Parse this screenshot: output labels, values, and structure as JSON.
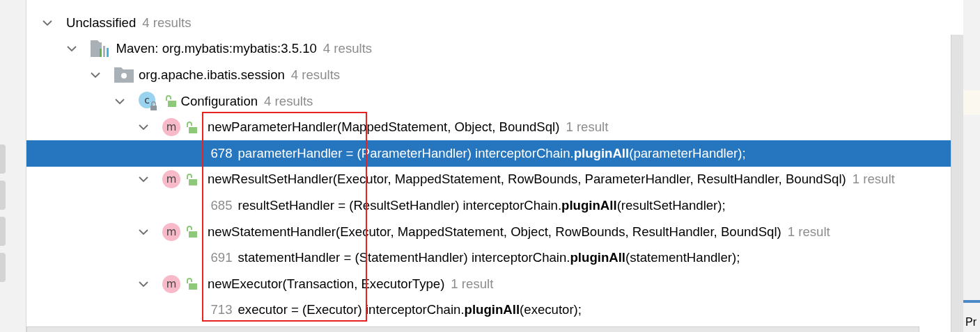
{
  "tree": [
    {
      "kind": "group",
      "label": "Unclassified",
      "count": "4 results",
      "expanded": true,
      "children": [
        {
          "kind": "library",
          "label": "Maven: org.mybatis:mybatis:3.5.10",
          "count": "4 results",
          "expanded": true,
          "children": [
            {
              "kind": "package",
              "label": "org.apache.ibatis.session",
              "count": "4 results",
              "expanded": true,
              "children": [
                {
                  "kind": "class",
                  "badge": "c",
                  "label": "Configuration",
                  "count": "4 results",
                  "expanded": true,
                  "children": [
                    {
                      "kind": "method",
                      "badge": "m",
                      "label": "newParameterHandler(MappedStatement, Object, BoundSql)",
                      "count": "1 result",
                      "expanded": true,
                      "children": [
                        {
                          "kind": "usage",
                          "line": "678",
                          "code": "parameterHandler = (ParameterHandler) interceptorChain.**pluginAll**(parameterHandler);",
                          "selected": true
                        }
                      ]
                    },
                    {
                      "kind": "method",
                      "badge": "m",
                      "label": "newResultSetHandler(Executor, MappedStatement, RowBounds, ParameterHandler, ResultHandler, BoundSql)",
                      "count": "1 result",
                      "expanded": true,
                      "children": [
                        {
                          "kind": "usage",
                          "line": "685",
                          "code": "resultSetHandler = (ResultSetHandler) interceptorChain.**pluginAll**(resultSetHandler);",
                          "selected": false
                        }
                      ]
                    },
                    {
                      "kind": "method",
                      "badge": "m",
                      "label": "newStatementHandler(Executor, MappedStatement, Object, RowBounds, ResultHandler, BoundSql)",
                      "count": "1 result",
                      "expanded": true,
                      "children": [
                        {
                          "kind": "usage",
                          "line": "691",
                          "code": "statementHandler = (StatementHandler) interceptorChain.**pluginAll**(statementHandler);",
                          "selected": false
                        }
                      ]
                    },
                    {
                      "kind": "method",
                      "badge": "m",
                      "label": "newExecutor(Transaction, ExecutorType)",
                      "count": "1 result",
                      "expanded": true,
                      "children": [
                        {
                          "kind": "usage",
                          "line": "713",
                          "code": "executor = (Executor) interceptorChain.**pluginAll**(executor);",
                          "selected": false
                        }
                      ]
                    }
                  ]
                }
              ]
            }
          ]
        }
      ]
    }
  ],
  "annotation": {
    "kind": "rectangle"
  },
  "side_panel": {
    "label": "Pr"
  }
}
